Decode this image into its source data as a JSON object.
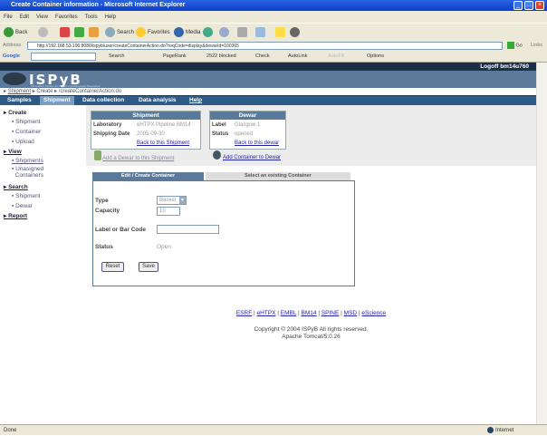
{
  "window": {
    "title": "Create Container information - Microsoft Internet Explorer"
  },
  "menu": [
    "File",
    "Edit",
    "View",
    "Favorites",
    "Tools",
    "Help"
  ],
  "toolbar": {
    "back": "Back",
    "search": "Search",
    "favorites": "Favorites",
    "media": "Media"
  },
  "address": {
    "label": "Address",
    "url": "http://192.168.53.196:8080/ispyb/user/createContainerAction.do?reqCode=display&dewarId=100365",
    "go": "Go",
    "links": "Links"
  },
  "google": {
    "logo": "Google",
    "search": "Search",
    "pagerank": "PageRank",
    "blocked": "2522 blocked",
    "check": "Check",
    "autolink": "AutoLink",
    "autofill": "AutoFill",
    "options": "Options"
  },
  "header": {
    "logoff": "Logoff bm14u760",
    "logo": "ISPyB",
    "tagline": "Information System for Protein crystallography Beamlines"
  },
  "breadcrumb": [
    "Shipment",
    "Create",
    "/createContainerAction.do"
  ],
  "nav": [
    "Samples",
    "Shipment",
    "Data collection",
    "Data analysis",
    "Help"
  ],
  "sidebar": {
    "create": "Create",
    "create_items": [
      "Shipment",
      "Container",
      "Upload"
    ],
    "view": "View",
    "view_items": [
      "Shipments",
      "Unasigned",
      "Containers"
    ],
    "search": "Search",
    "search_items": [
      "Shipment",
      "Dewar"
    ],
    "report": "Report"
  },
  "shipment": {
    "title": "Shipment",
    "lab_label": "Laboratory",
    "lab": "eHTPX Pipeline BM14",
    "date_label": "Shipping Date",
    "date": "2005-09-30",
    "back": "Back to this Shipment",
    "add_dewar": "Add a Dewar to this Shipment"
  },
  "dewar": {
    "title": "Dewar",
    "label_label": "Label",
    "label": "Glasgow 1",
    "status_label": "Status",
    "status": "opened",
    "back": "Back to this dewar",
    "add_container": "Add Container to Dewar"
  },
  "tabs": {
    "edit": "Edit / Create Container",
    "select": "Select an existing Container"
  },
  "form": {
    "type_label": "Type",
    "type": "Basket",
    "capacity_label": "Capacity",
    "capacity": "10",
    "barcode_label": "Label or Bar Code",
    "barcode": "",
    "status_label": "Status",
    "status": "Open",
    "reset": "Reset",
    "save": "Save"
  },
  "footer": {
    "links": [
      "ESRF",
      "eHTPX",
      "EMBL",
      "BM14",
      "SPINE",
      "MSD",
      "eScience"
    ],
    "copyright": "Copyright © 2004 ISPyB All rights reserved.",
    "server": "Apache Tomcat/5.0.26"
  },
  "status": {
    "left": "Done",
    "zone": "Internet"
  }
}
